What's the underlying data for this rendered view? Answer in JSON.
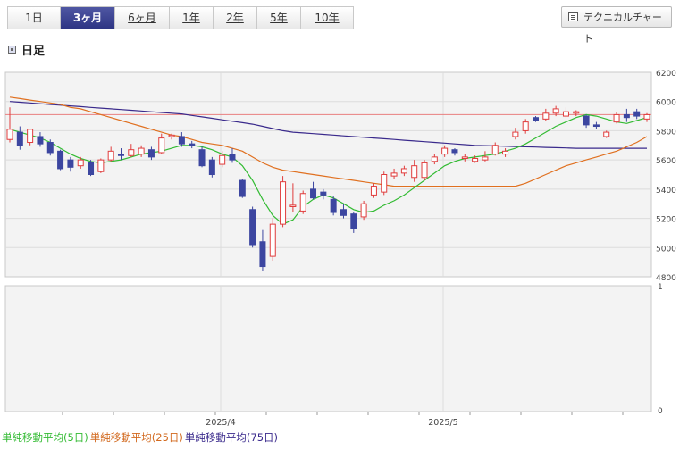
{
  "tabs": [
    {
      "label": "1日",
      "active": false
    },
    {
      "label": "3ヶ月",
      "active": true
    },
    {
      "label": "6ヶ月",
      "active": false
    },
    {
      "label": "1年",
      "active": false
    },
    {
      "label": "2年",
      "active": false
    },
    {
      "label": "5年",
      "active": false
    },
    {
      "label": "10年",
      "active": false
    }
  ],
  "tech_button": "テクニカルチャート",
  "section_title": "日足",
  "legend": [
    {
      "label": "単純移動平均(5日)",
      "color": "#33bb33"
    },
    {
      "label": "単純移動平均(25日)",
      "color": "#d2691e"
    },
    {
      "label": "単純移動平均(75日)",
      "color": "#3a2a8c"
    }
  ],
  "chart_data": {
    "type": "candlestick",
    "y_ticks": [
      "6200",
      "6000",
      "5800",
      "5600",
      "5400",
      "5200",
      "5000",
      "4800"
    ],
    "ylim": [
      4800,
      6200
    ],
    "volume_ticks": [
      "1",
      "0"
    ],
    "x_labels": [
      "2025/4",
      "2025/5"
    ],
    "reference_line": 5910,
    "colors": {
      "up": "#e03c3c",
      "down": "#3c46a0",
      "ma5": "#33bb33",
      "ma25": "#e07020",
      "ma75": "#3a2a8c",
      "ref": "#e88080"
    },
    "candles": [
      [
        5740,
        5960,
        5810,
        5720
      ],
      [
        5790,
        5830,
        5700,
        5670
      ],
      [
        5720,
        5780,
        5810,
        5700
      ],
      [
        5760,
        5790,
        5710,
        5690
      ],
      [
        5720,
        5740,
        5650,
        5630
      ],
      [
        5660,
        5670,
        5540,
        5530
      ],
      [
        5600,
        5620,
        5550,
        5520
      ],
      [
        5560,
        5620,
        5600,
        5540
      ],
      [
        5580,
        5600,
        5500,
        5490
      ],
      [
        5520,
        5610,
        5600,
        5510
      ],
      [
        5600,
        5690,
        5660,
        5590
      ],
      [
        5640,
        5680,
        5630,
        5600
      ],
      [
        5630,
        5710,
        5670,
        5620
      ],
      [
        5640,
        5700,
        5680,
        5620
      ],
      [
        5670,
        5690,
        5620,
        5600
      ],
      [
        5650,
        5780,
        5750,
        5640
      ],
      [
        5760,
        5780,
        5770,
        5740
      ],
      [
        5760,
        5790,
        5710,
        5690
      ],
      [
        5710,
        5730,
        5700,
        5680
      ],
      [
        5670,
        5690,
        5560,
        5550
      ],
      [
        5600,
        5620,
        5500,
        5480
      ],
      [
        5570,
        5660,
        5630,
        5550
      ],
      [
        5640,
        5680,
        5600,
        5580
      ],
      [
        5460,
        5470,
        5350,
        5340
      ],
      [
        5260,
        5280,
        5020,
        5000
      ],
      [
        5040,
        5120,
        4870,
        4840
      ],
      [
        4940,
        5200,
        5160,
        4910
      ],
      [
        5160,
        5490,
        5450,
        5140
      ],
      [
        5280,
        5440,
        5290,
        5240
      ],
      [
        5250,
        5390,
        5370,
        5230
      ],
      [
        5400,
        5450,
        5340,
        5330
      ],
      [
        5380,
        5400,
        5360,
        5330
      ],
      [
        5330,
        5350,
        5240,
        5220
      ],
      [
        5260,
        5300,
        5220,
        5200
      ],
      [
        5230,
        5240,
        5130,
        5100
      ],
      [
        5210,
        5320,
        5300,
        5190
      ],
      [
        5360,
        5440,
        5420,
        5340
      ],
      [
        5380,
        5520,
        5500,
        5360
      ],
      [
        5490,
        5540,
        5510,
        5470
      ],
      [
        5510,
        5560,
        5540,
        5490
      ],
      [
        5480,
        5600,
        5560,
        5450
      ],
      [
        5480,
        5600,
        5580,
        5460
      ],
      [
        5590,
        5640,
        5620,
        5570
      ],
      [
        5640,
        5700,
        5680,
        5620
      ],
      [
        5670,
        5680,
        5650,
        5630
      ],
      [
        5610,
        5640,
        5620,
        5590
      ],
      [
        5590,
        5630,
        5610,
        5580
      ],
      [
        5600,
        5660,
        5620,
        5590
      ],
      [
        5640,
        5720,
        5700,
        5630
      ],
      [
        5640,
        5680,
        5660,
        5620
      ],
      [
        5760,
        5820,
        5790,
        5740
      ],
      [
        5800,
        5880,
        5860,
        5780
      ],
      [
        5890,
        5900,
        5870,
        5860
      ],
      [
        5880,
        5950,
        5920,
        5870
      ],
      [
        5920,
        5970,
        5950,
        5900
      ],
      [
        5900,
        5960,
        5930,
        5890
      ],
      [
        5920,
        5940,
        5930,
        5900
      ],
      [
        5900,
        5910,
        5840,
        5820
      ],
      [
        5840,
        5860,
        5830,
        5810
      ],
      [
        5760,
        5800,
        5790,
        5750
      ],
      [
        5860,
        5930,
        5910,
        5850
      ],
      [
        5910,
        5950,
        5890,
        5860
      ],
      [
        5930,
        5950,
        5900,
        5880
      ],
      [
        5880,
        5920,
        5910,
        5860
      ]
    ],
    "ma5": [
      5810,
      5790,
      5770,
      5750,
      5720,
      5680,
      5640,
      5610,
      5590,
      5580,
      5590,
      5600,
      5620,
      5640,
      5650,
      5660,
      5680,
      5700,
      5700,
      5690,
      5670,
      5640,
      5620,
      5560,
      5460,
      5330,
      5220,
      5160,
      5190,
      5280,
      5330,
      5360,
      5340,
      5300,
      5260,
      5240,
      5250,
      5290,
      5320,
      5360,
      5410,
      5460,
      5510,
      5560,
      5590,
      5610,
      5620,
      5630,
      5640,
      5660,
      5680,
      5710,
      5750,
      5790,
      5830,
      5860,
      5890,
      5910,
      5900,
      5880,
      5860,
      5850,
      5870,
      5890
    ],
    "ma25": [
      6030,
      6020,
      6010,
      6000,
      5990,
      5980,
      5960,
      5950,
      5930,
      5910,
      5890,
      5870,
      5850,
      5830,
      5810,
      5790,
      5770,
      5760,
      5740,
      5720,
      5710,
      5700,
      5680,
      5660,
      5620,
      5580,
      5550,
      5530,
      5520,
      5510,
      5500,
      5490,
      5480,
      5470,
      5460,
      5450,
      5440,
      5430,
      5420,
      5420,
      5420,
      5420,
      5420,
      5420,
      5420,
      5420,
      5420,
      5420,
      5420,
      5420,
      5420,
      5440,
      5470,
      5500,
      5530,
      5560,
      5580,
      5600,
      5620,
      5640,
      5660,
      5690,
      5720,
      5760
    ],
    "ma75": [
      6000,
      5995,
      5990,
      5985,
      5980,
      5975,
      5970,
      5965,
      5960,
      5955,
      5950,
      5945,
      5940,
      5935,
      5930,
      5925,
      5920,
      5915,
      5905,
      5895,
      5885,
      5875,
      5865,
      5855,
      5845,
      5830,
      5815,
      5800,
      5790,
      5785,
      5780,
      5775,
      5770,
      5765,
      5760,
      5755,
      5750,
      5745,
      5740,
      5735,
      5730,
      5725,
      5720,
      5715,
      5710,
      5705,
      5700,
      5698,
      5696,
      5694,
      5692,
      5690,
      5688,
      5686,
      5684,
      5682,
      5680,
      5680,
      5680,
      5680,
      5680,
      5680,
      5680,
      5680
    ]
  }
}
